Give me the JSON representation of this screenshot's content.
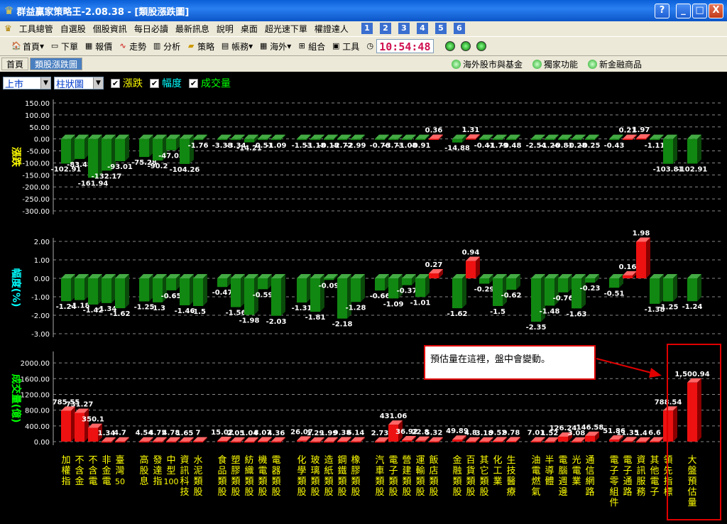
{
  "window": {
    "title": "群益贏家策略王-2.08.38 - [類股漲跌圖]",
    "buttons": [
      "?",
      "_",
      "□",
      "X"
    ]
  },
  "menu": {
    "items": [
      "工具總管",
      "自選股",
      "個股資訊",
      "每日必讀",
      "最新訊息",
      "說明",
      "桌面",
      "超光速下單",
      "權證達人"
    ],
    "numbers": [
      "1",
      "2",
      "3",
      "4",
      "5",
      "6"
    ]
  },
  "toolbar": {
    "items": [
      "首頁",
      "下單",
      "報價",
      "走勢",
      "分析",
      "策略",
      "帳務",
      "海外",
      "組合",
      "工具"
    ],
    "clock": "10:54:48"
  },
  "tabs": {
    "items": [
      "首頁",
      "類股漲跌圖"
    ],
    "right_links": [
      "海外股市與基金",
      "獨家功能",
      "新金融商品"
    ]
  },
  "controls": {
    "market": "上市",
    "chart_type": "柱狀圖",
    "checks": [
      "漲跌",
      "幅度",
      "成交量"
    ]
  },
  "annotation": {
    "text": "預估量在這裡，盤中會變動。"
  },
  "chart_data": [
    {
      "type": "bar",
      "name": "漲跌",
      "ylabel": "漲跌",
      "yticks": [
        "150.00",
        "100.00",
        "50.00",
        "0.00",
        "-50.00",
        "-100.00",
        "-150.00",
        "-200.00",
        "-250.00",
        "-300.00"
      ],
      "ylim": [
        -300,
        150
      ],
      "labels": [
        "-102.91",
        "-83.48",
        "-161.94",
        "-132.17",
        "-93.01",
        "-75.28",
        "-90.2",
        "-47.05",
        "-104.26",
        "-1.76",
        "-3.38",
        "-3.34",
        "-14.21",
        "-0.51",
        "-1.09",
        "-1.53",
        "-1.18",
        "-0.18",
        "-2.72",
        "-2.99",
        "-0.76",
        "-3.73",
        "-1.08",
        "-0.91",
        "0.36",
        "-14.88",
        "1.31",
        "-0.41",
        "-1.79",
        "-0.48",
        "-2.54",
        "-1.26",
        "-0.81",
        "-0.28",
        "-0.25",
        "-0.43",
        "0.21",
        "1.97",
        "-1.11",
        "-103.81",
        "-102.91"
      ]
    },
    {
      "type": "bar",
      "name": "幅度",
      "ylabel": "幅度(%)",
      "yticks": [
        "2.00",
        "1.00",
        "0.00",
        "-1.00",
        "-2.00",
        "-3.00"
      ],
      "ylim": [
        -3,
        2
      ],
      "labels": [
        "-1.24",
        "-1.18",
        "-1.42",
        "-1.34",
        "-1.62",
        "-1.25",
        "-1.3",
        "-0.65",
        "-1.46",
        "-1.5",
        "-0.47",
        "-1.56",
        "-1.98",
        "-0.59",
        "-2.03",
        "-1.31",
        "-1.81",
        "-0.09",
        "-2.18",
        "-1.28",
        "-0.66",
        "-1.09",
        "-0.37",
        "-1.01",
        "0.27",
        "-1.62",
        "0.94",
        "-0.29",
        "-1.5",
        "-0.62",
        "-2.35",
        "-1.48",
        "-0.76",
        "-1.63",
        "-0.23",
        "-0.51",
        "0.16",
        "1.98",
        "-1.38",
        "-1.25",
        "-1.24"
      ]
    },
    {
      "type": "bar",
      "name": "成交量",
      "ylabel": "成交量(億)",
      "yticks": [
        "2000.00",
        "1600.00",
        "1200.00",
        "800.00",
        "400.00",
        "0.00"
      ],
      "ylim": [
        0,
        2200
      ],
      "labels": [
        "785.55",
        "731.27",
        "350.1",
        "1.34",
        "4.7",
        "4.54",
        "4.75",
        "4.78",
        "1.65",
        "7",
        "15.02",
        "2.05",
        "1.04",
        "8.07",
        "4.36",
        "26.07",
        "1.29",
        "1.99",
        "9.38",
        "6.14",
        "2.73",
        "431.06",
        "36.92",
        "22.8",
        "5.32",
        "49.89",
        "4.8",
        "3.18",
        "9.52",
        "9.78",
        "7.01",
        "1.52",
        "126.24",
        "3.08",
        "146.58",
        "51.86",
        "11.35",
        "1.4",
        "6.6",
        "788.54",
        "1,500.94"
      ]
    }
  ],
  "categories": [
    {
      "name": "加權指",
      "color": "#ffff00"
    },
    {
      "name": "不含金",
      "color": "#ffff00"
    },
    {
      "name": "不含電",
      "color": "#ffff00"
    },
    {
      "name": "非金電",
      "color": "#ffff00"
    },
    {
      "name": "臺灣50",
      "color": "#ffff00"
    },
    {
      "name": "高股息",
      "color": "#ffff00"
    },
    {
      "name": "發達指",
      "color": "#ffff00"
    },
    {
      "name": "中型100",
      "color": "#ffff00"
    },
    {
      "name": "資訊科技",
      "color": "#ffff00"
    },
    {
      "name": "水泥類股",
      "color": "#ffff00"
    },
    {
      "name": "食品類股",
      "color": "#ffff00"
    },
    {
      "name": "塑膠類股",
      "color": "#ffff00"
    },
    {
      "name": "紡織類股",
      "color": "#ffff00"
    },
    {
      "name": "機電類股",
      "color": "#ffff00"
    },
    {
      "name": "電器類股",
      "color": "#ffff00"
    },
    {
      "name": "化學類股",
      "color": "#ffff00"
    },
    {
      "name": "玻璃類股",
      "color": "#ffff00"
    },
    {
      "name": "造紙類股",
      "color": "#ffff00"
    },
    {
      "name": "鋼鐵類股",
      "color": "#ffff00"
    },
    {
      "name": "橡膠類股",
      "color": "#ffff00"
    },
    {
      "name": "汽車類股",
      "color": "#ffff00"
    },
    {
      "name": "電子類股",
      "color": "#ffff00"
    },
    {
      "name": "營建類股",
      "color": "#ffff00"
    },
    {
      "name": "運輸類股",
      "color": "#ffff00"
    },
    {
      "name": "飯店類股",
      "color": "#ffff00"
    },
    {
      "name": "金融類股",
      "color": "#ffff00"
    },
    {
      "name": "百貨類股",
      "color": "#ffff00"
    },
    {
      "name": "其它類股",
      "color": "#ffff00"
    },
    {
      "name": "化工業",
      "color": "#ffff00"
    },
    {
      "name": "生技醫療",
      "color": "#ffff00"
    },
    {
      "name": "油電燃氣",
      "color": "#ffff00"
    },
    {
      "name": "半導體",
      "color": "#ffff00"
    },
    {
      "name": "電腦週邊",
      "color": "#ffff00"
    },
    {
      "name": "光電業",
      "color": "#ffff00"
    },
    {
      "name": "通信網路",
      "color": "#ffff00"
    },
    {
      "name": "電子零組件",
      "color": "#ffff00"
    },
    {
      "name": "電子通路",
      "color": "#ffff00"
    },
    {
      "name": "資訊服務",
      "color": "#ffff00"
    },
    {
      "name": "其他電子",
      "color": "#ffff00"
    },
    {
      "name": "領先指標",
      "color": "#ffff00"
    },
    {
      "name": "大盤預估量",
      "color": "#ffff00"
    }
  ],
  "colors": {
    "up": "#ee1111",
    "down": "#118811",
    "grid": "#888888",
    "axis_text": "#ffffff",
    "yellow": "#ffff00",
    "annotation_border": "#e00000"
  }
}
